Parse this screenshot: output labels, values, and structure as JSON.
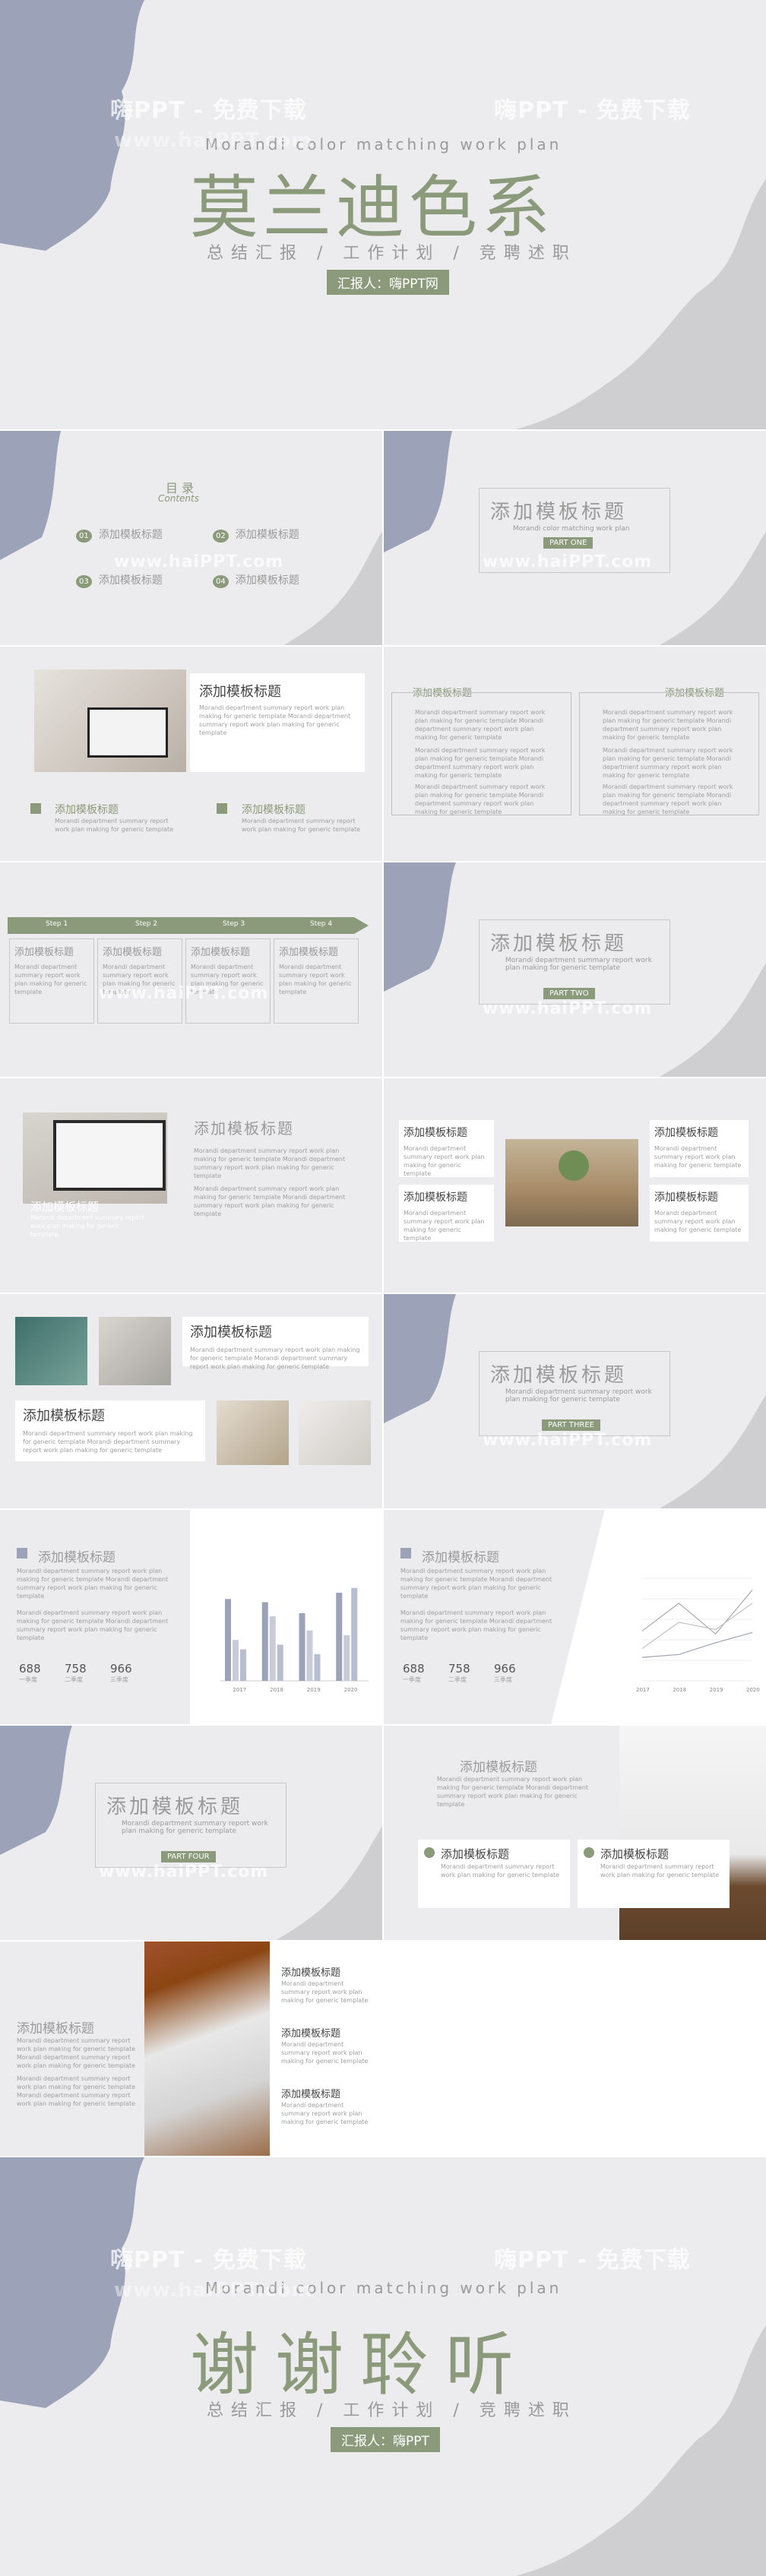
{
  "watermark": {
    "line1": "嗨PPT - 免费下载",
    "line2": "www.haiPPT.com"
  },
  "cover": {
    "en_subtitle": "Morandi color matching work plan",
    "title": "莫兰迪色系",
    "tagline": "总结汇报 / 工作计划 / 竞聘述职",
    "reporter": "汇报人：嗨PPT网"
  },
  "contents": {
    "heading_cn": "目 录",
    "heading_en": "Contents",
    "items": [
      {
        "num": "01",
        "label": "添加模板标题"
      },
      {
        "num": "02",
        "label": "添加模板标题"
      },
      {
        "num": "03",
        "label": "添加模板标题"
      },
      {
        "num": "04",
        "label": "添加模板标题"
      }
    ]
  },
  "section1": {
    "title": "添加模板标题",
    "en": "Morandi color matching work plan",
    "part": "PART ONE"
  },
  "section2": {
    "title": "添加模板标题",
    "en": "Morandi department summary report work plan making for generic template",
    "part": "PART TWO"
  },
  "section3": {
    "title": "添加模板标题",
    "en": "Morandi department summary report work plan making for generic template",
    "part": "PART THREE"
  },
  "section4": {
    "title": "添加模板标题",
    "en": "Morandi department summary report work plan making for generic template",
    "part": "PART FOUR"
  },
  "common": {
    "block_title": "添加模板标题",
    "body": "Morandi department summary report work plan making for generic template Morandi department summary report work plan making for generic template",
    "body_short": "Morandi department summary report work plan making for generic template"
  },
  "steps": [
    "Step 1",
    "Step 2",
    "Step 3",
    "Step 4"
  ],
  "stats": [
    {
      "value": "688",
      "label": "一季度"
    },
    {
      "value": "758",
      "label": "二季度"
    },
    {
      "value": "966",
      "label": "三季度"
    }
  ],
  "chart_years": [
    "2017",
    "2018",
    "2019",
    "2020"
  ],
  "chart_data": [
    {
      "type": "bar",
      "categories": [
        "2017",
        "2018",
        "2019",
        "2020"
      ],
      "series": [
        {
          "values": [
            5.2,
            5.0,
            4.3,
            5.6
          ]
        },
        {
          "values": [
            2.6,
            4.1,
            3.2,
            2.9
          ]
        },
        {
          "values": [
            2.0,
            2.3,
            1.7,
            5.9
          ]
        }
      ]
    },
    {
      "type": "line",
      "categories": [
        "2017",
        "2018",
        "2019",
        "2020"
      ],
      "series": [
        {
          "values": [
            3.4,
            5.3,
            3.2,
            6.2
          ]
        },
        {
          "values": [
            2.2,
            4.0,
            3.5,
            5.3
          ]
        },
        {
          "values": [
            1.6,
            1.8,
            2.6,
            3.3
          ]
        }
      ]
    }
  ],
  "thanks": {
    "en_subtitle": "Morandi color matching work plan",
    "title": "谢谢聆听",
    "tagline": "总结汇报 / 工作计划 / 竞聘述职",
    "reporter": "汇报人：嗨PPT"
  },
  "colors": {
    "accent": "#8b9a7a",
    "lavender": "#9ca3b8",
    "bg": "#ecebed",
    "grey_stroke": "#c9c8ca"
  }
}
